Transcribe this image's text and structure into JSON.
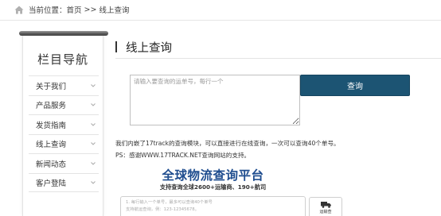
{
  "breadcrumb": {
    "prefix": "当前位置：",
    "home": "首页",
    "separator": ">>",
    "current": "线上查询",
    "icon": "home-icon"
  },
  "sidebar": {
    "title": "栏目导航",
    "items": [
      {
        "label": "关于我们",
        "icon": "chevron-down-icon"
      },
      {
        "label": "产品服务",
        "icon": "chevron-down-icon"
      },
      {
        "label": "发货指南",
        "icon": "chevron-down-icon"
      },
      {
        "label": "线上查询",
        "icon": "chevron-down-icon"
      },
      {
        "label": "新闻动态",
        "icon": "chevron-down-icon"
      },
      {
        "label": "客户登陆",
        "icon": "chevron-down-icon"
      }
    ]
  },
  "main": {
    "title": "线上查询",
    "input_placeholder": "请输入要查询的运单号，每行一个",
    "query_button": "查询",
    "desc_line1": "我们内嵌了17track的查询模块，可以直接进行在线查询，一次可以查询40个单号。",
    "desc_line2": "PS：感谢WWW.17TRACK.NET查询网站的支持。"
  },
  "banner": {
    "title": "全球物流查询平台",
    "subtitle": "支持查询全球2600+运输商、190+航司",
    "line1": "1. 每行输入一个单号，最多可以查询40个单号",
    "line2": "支持航运查询，例：123-12345678。",
    "button_label": "运输查",
    "icon": "truck-icon"
  },
  "colors": {
    "button_bg": "#1c5473",
    "banner_title": "#1f4d8f",
    "rod": "#555555"
  }
}
